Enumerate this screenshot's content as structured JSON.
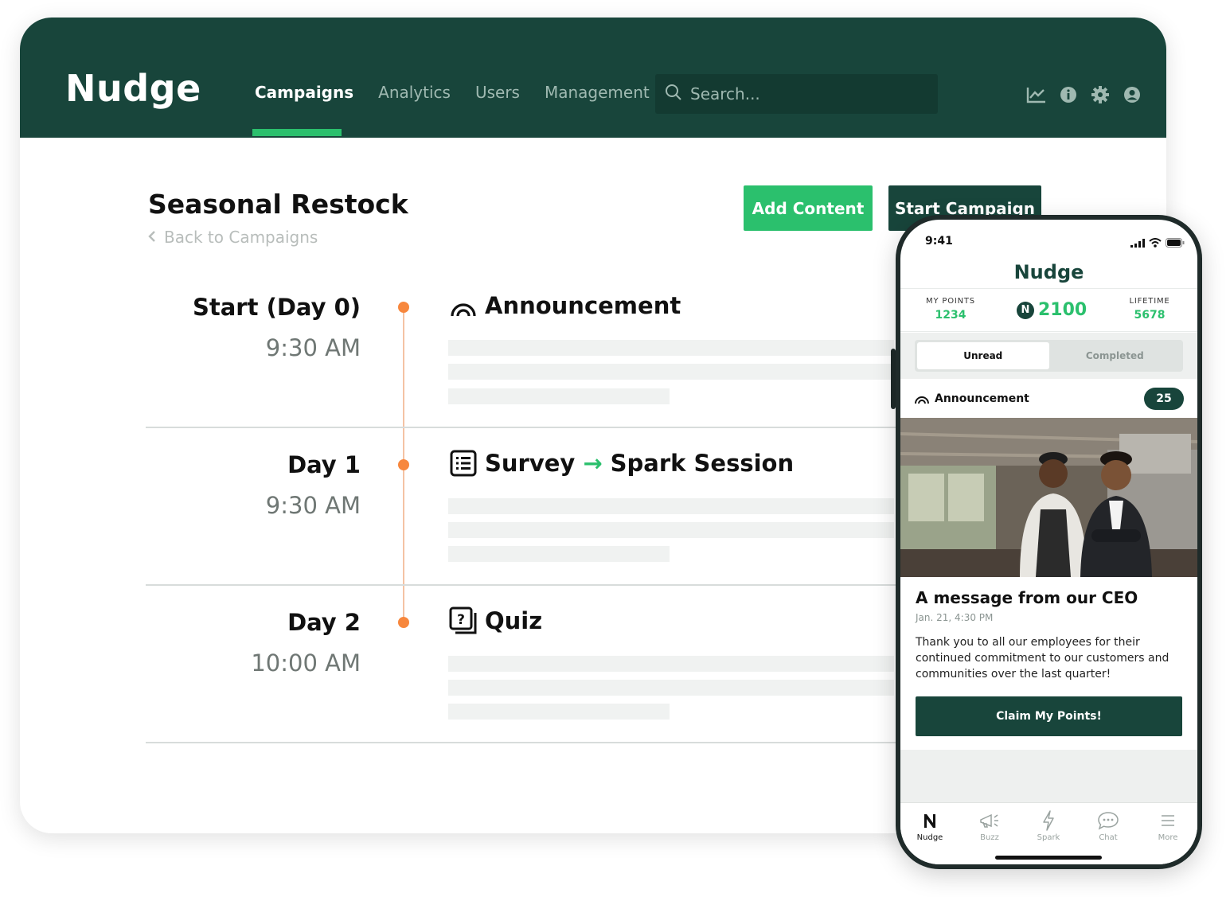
{
  "app": {
    "logo": "Nudge",
    "nav": [
      "Campaigns",
      "Analytics",
      "Users",
      "Management"
    ],
    "active_nav": "Campaigns",
    "search_placeholder": "Search..."
  },
  "campaign": {
    "title": "Seasonal Restock",
    "back_label": "Back to Campaigns",
    "add_content_label": "Add Content",
    "start_label": "Start Campaign"
  },
  "timeline": [
    {
      "day": "Start (Day 0)",
      "time": "9:30 AM",
      "content": "Announcement",
      "icon": "announcement-icon"
    },
    {
      "day": "Day 1",
      "time": "9:30 AM",
      "content": "Survey",
      "arrow": "→",
      "content2": "Spark Session",
      "icon": "survey-icon"
    },
    {
      "day": "Day 2",
      "time": "10:00 AM",
      "content": "Quiz",
      "icon": "quiz-icon"
    }
  ],
  "phone": {
    "status_time": "9:41",
    "logo": "Nudge",
    "my_points_label": "MY POINTS",
    "my_points": "1234",
    "badge": "N",
    "balance": "2100",
    "lifetime_label": "LIFETIME",
    "lifetime": "5678",
    "tabs": [
      "Unread",
      "Completed"
    ],
    "card": {
      "type_label": "Announcement",
      "count": "25",
      "title": "A message from our CEO",
      "date": "Jan. 21, 4:30 PM",
      "body": "Thank you to all our employees for their continued commitment to our customers and communities over the last quarter!",
      "cta": "Claim My Points!"
    },
    "bottom_tabs": [
      "Nudge",
      "Buzz",
      "Spark",
      "Chat",
      "More"
    ]
  },
  "colors": {
    "brand_dark": "#18453b",
    "accent_green": "#2bc06d",
    "timeline_orange": "#f7873d"
  }
}
